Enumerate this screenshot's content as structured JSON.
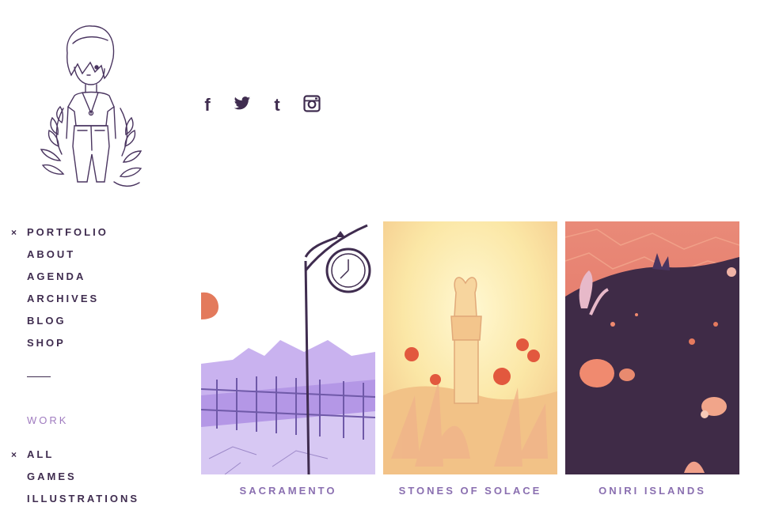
{
  "social": {
    "facebook_glyph": "f",
    "tumblr_glyph": "t"
  },
  "nav": {
    "active_marker": "×",
    "items": [
      {
        "label": "PORTFOLIO"
      },
      {
        "label": "ABOUT"
      },
      {
        "label": "AGENDA"
      },
      {
        "label": "ARCHIVES"
      },
      {
        "label": "BLOG"
      },
      {
        "label": "SHOP"
      }
    ]
  },
  "work": {
    "title": "WORK",
    "active_marker": "×",
    "filters": [
      {
        "label": "ALL"
      },
      {
        "label": "GAMES"
      },
      {
        "label": "ILLUSTRATIONS"
      }
    ]
  },
  "gallery": {
    "items": [
      {
        "title": "SACRAMENTO"
      },
      {
        "title": "STONES OF SOLACE"
      },
      {
        "title": "ONIRI ISLANDS"
      }
    ]
  },
  "colors": {
    "text": "#3f2c4f",
    "accent": "#a07cc0",
    "caption": "#8a6fb0"
  }
}
